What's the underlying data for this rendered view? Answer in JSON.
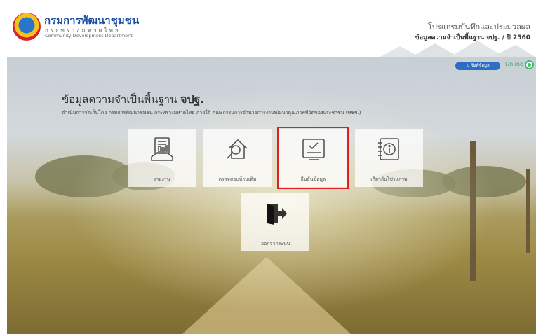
{
  "header": {
    "org_name_th": "กรมการพัฒนาชุมชน",
    "org_ministry_th": "กระทรวงมหาดไทย",
    "org_name_en": "Community Development Department",
    "program_title": "โปรแกรมบันทึกและประมวลผล",
    "program_subtitle": "ข้อมูลความจำเป็นพื้นฐาน จปฐ. / ปี 2560"
  },
  "status": {
    "sync_button": "↻ ซิงค์ข้อมูล",
    "online_label": "Online"
  },
  "main": {
    "title_prefix": "ข้อมูลความจำเป็นพื้นฐาน",
    "title_emph": "จปฐ.",
    "description": "ดำเนินการจัดเก็บโดย กรมการพัฒนาชุมชน กระทรวงมหาดไทย ภายใต้ คณะกรรมการอำนวยการงานพัฒนาคุณภาพชีวิตของประชาชน (พชช.)"
  },
  "menu": [
    {
      "label": "รายงาน",
      "icon": "report-icon"
    },
    {
      "label": "ตรวจสอบบ้านเดิม",
      "icon": "house-search-icon"
    },
    {
      "label": "ยืนยันข้อมูล",
      "icon": "confirm-data-icon"
    },
    {
      "label": "เกี่ยวกับโปรแกรม",
      "icon": "info-icon"
    },
    {
      "label": "ออกจากระบบ",
      "icon": "logout-icon"
    }
  ],
  "colors": {
    "brand_blue": "#1c4fa3",
    "sync_button": "#2d6ec4",
    "online": "#39c16a",
    "highlight": "#e01f1f"
  }
}
